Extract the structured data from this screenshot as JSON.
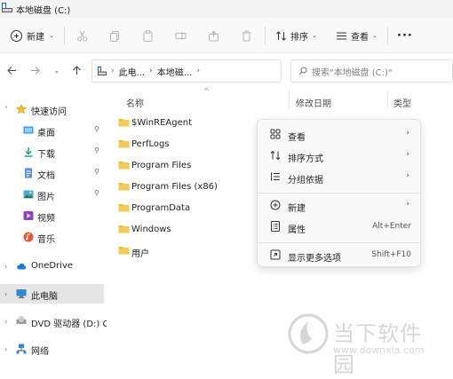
{
  "window": {
    "title": "本地磁盘 (C:)"
  },
  "toolbar": {
    "new_label": "新建",
    "sort_label": "排序",
    "view_label": "查看",
    "more_label": "···"
  },
  "address": {
    "crumbs": [
      "此电...",
      "本地磁..."
    ],
    "search_placeholder": "搜索\"本地磁盘 (C:)\""
  },
  "sidebar": {
    "items": [
      {
        "label": "快速访问",
        "icon": "star-icon",
        "expander": "˅"
      },
      {
        "label": "桌面",
        "icon": "desktop-icon",
        "pinned": "📌"
      },
      {
        "label": "下载",
        "icon": "download-icon",
        "pinned": "📌"
      },
      {
        "label": "文档",
        "icon": "document-icon",
        "pinned": "📌"
      },
      {
        "label": "图片",
        "icon": "pictures-icon",
        "pinned": "📌"
      },
      {
        "label": "视频",
        "icon": "video-icon"
      },
      {
        "label": "音乐",
        "icon": "music-icon"
      },
      {
        "label": "OneDrive",
        "icon": "cloud-icon",
        "expander": "›"
      },
      {
        "label": "此电脑",
        "icon": "computer-icon",
        "expander": "›"
      },
      {
        "label": "DVD 驱动器 (D:) CF",
        "icon": "dvd-icon",
        "expander": "›"
      },
      {
        "label": "网络",
        "icon": "network-icon",
        "expander": "›"
      }
    ]
  },
  "files": {
    "columns": {
      "name": "名称",
      "date": "修改日期",
      "type": "类型"
    },
    "rows": [
      "$WinREAgent",
      "PerfLogs",
      "Program Files",
      "Program Files (x86)",
      "ProgramData",
      "Windows",
      "用户"
    ]
  },
  "context_menu": {
    "items": [
      {
        "label": "查看",
        "icon": "view-grid-icon",
        "submenu": "›"
      },
      {
        "label": "排序方式",
        "icon": "sort-icon",
        "submenu": "›"
      },
      {
        "label": "分组依据",
        "icon": "group-icon",
        "submenu": "›"
      },
      {
        "label": "新建",
        "icon": "new-plus-icon",
        "submenu": "›"
      },
      {
        "label": "属性",
        "icon": "properties-icon",
        "shortcut": "Alt+Enter"
      },
      {
        "label": "显示更多选项",
        "icon": "more-options-icon",
        "shortcut": "Shift+F10"
      }
    ]
  },
  "watermark": {
    "brand": "当下软件园",
    "url": "www.downxia.com"
  },
  "colors": {
    "folder": "#e9b93c",
    "accent": "#0067c0",
    "selection": "#e5e5e5"
  }
}
